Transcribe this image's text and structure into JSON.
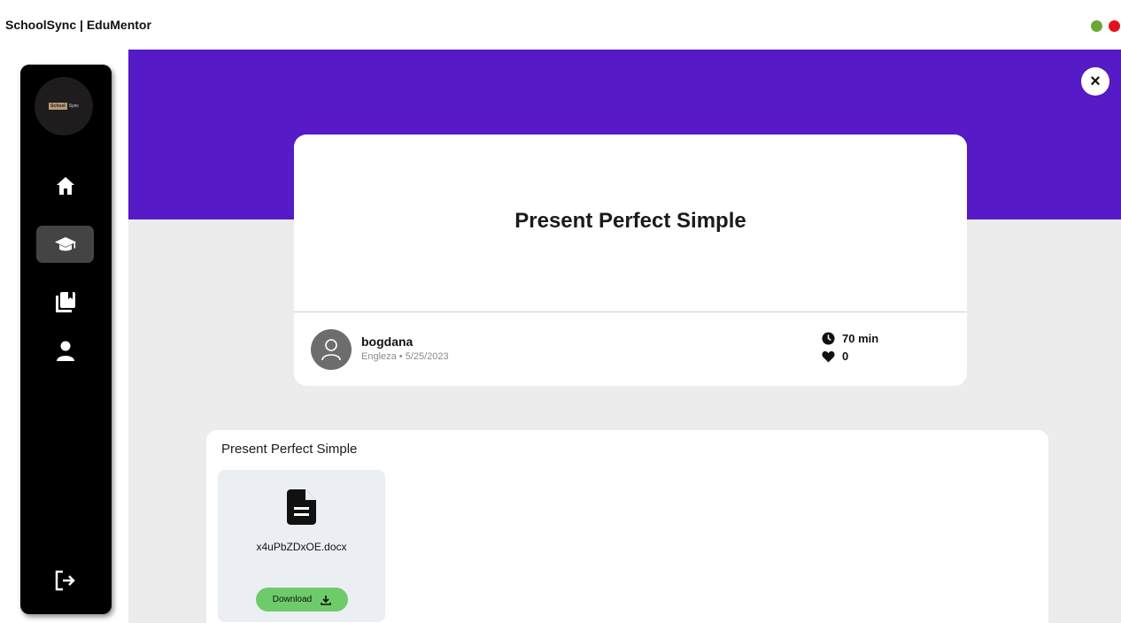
{
  "window": {
    "title": "SchoolSync | EduMentor",
    "controls": {
      "green": "#6aa832",
      "red": "#e3121a"
    }
  },
  "sidebar": {
    "logo": {
      "text_primary": "School",
      "text_secondary": "Sync"
    },
    "items": [
      {
        "icon": "home-icon",
        "active": false
      },
      {
        "icon": "graduation-cap-icon",
        "active": true
      },
      {
        "icon": "book-icon",
        "active": false
      },
      {
        "icon": "user-icon",
        "active": false
      }
    ],
    "logout_icon": "logout-icon"
  },
  "colors": {
    "hero": "#561ac6",
    "sidebar": "#000000",
    "download": "#6ecb6a",
    "background": "#ececec"
  },
  "lesson": {
    "title": "Present Perfect Simple",
    "author": "bogdana",
    "meta": "Engleza • 5/25/2023",
    "duration": "70 min",
    "likes": "0"
  },
  "files": {
    "heading": "Present Perfect Simple",
    "items": [
      {
        "name": "x4uPbZDxOE.docx",
        "download_label": "Download"
      }
    ]
  }
}
